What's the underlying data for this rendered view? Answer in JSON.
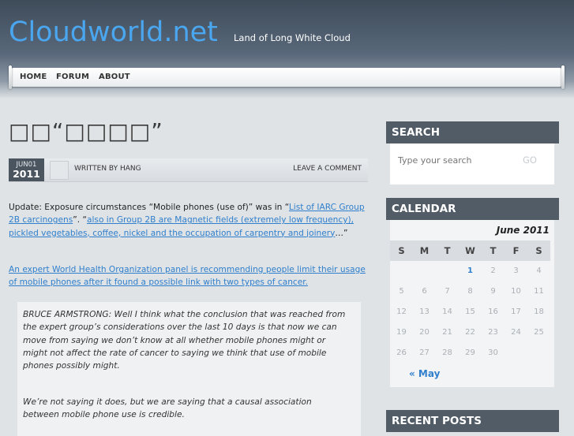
{
  "header": {
    "site_title": "Cloudworld.net",
    "tagline": "Land of Long White Cloud"
  },
  "nav": {
    "items": [
      {
        "label": "HOME"
      },
      {
        "label": "FORUM"
      },
      {
        "label": "ABOUT"
      }
    ]
  },
  "post": {
    "title": "□□“□□□□”",
    "date": {
      "month_day": "JUN01",
      "year": "2011"
    },
    "written_by": "WRITTEN BY HANG",
    "leave_comment": "LEAVE A COMMENT",
    "para1": {
      "prefix": "Update: Exposure circumstances “Mobile phones (use of)” was in “",
      "link1": "List of IARC Group 2B carcinogens",
      "middle": "”. “",
      "link2": "also in Group 2B are Magnetic fields (extremely low frequency), pickled vegetables, coffee, nickel and the occupation of carpentry and joinery",
      "suffix": "…”"
    },
    "para2_link": "An expert World Health Organization panel is recommending people limit their usage of mobile phones after it found a possible link with two types of cancer.",
    "quote": {
      "p1": "BRUCE ARMSTRONG: Well I think what the conclusion that was reached from the expert group’s considerations over the last 10 days is that now we can move from saying we don’t know at all whether mobile phones might or might not affect the rate of cancer to saying we think that use of mobile phones possibly might.",
      "p2": "We’re not saying it does, but we are saying that a causal association between mobile phone use is credible."
    }
  },
  "sidebar": {
    "search": {
      "title": "SEARCH",
      "placeholder": "Type your search",
      "go_label": "GO"
    },
    "calendar": {
      "title": "CALENDAR",
      "caption": "June 2011",
      "weekdays": [
        "S",
        "M",
        "T",
        "W",
        "T",
        "F",
        "S"
      ],
      "weeks": [
        [
          "",
          "",
          "",
          "1",
          "2",
          "3",
          "4"
        ],
        [
          "5",
          "6",
          "7",
          "8",
          "9",
          "10",
          "11"
        ],
        [
          "12",
          "13",
          "14",
          "15",
          "16",
          "17",
          "18"
        ],
        [
          "19",
          "20",
          "21",
          "22",
          "23",
          "24",
          "25"
        ],
        [
          "26",
          "27",
          "28",
          "29",
          "30",
          "",
          ""
        ]
      ],
      "linked_day": "1",
      "prev_label": "« May"
    },
    "recent_posts": {
      "title": "RECENT POSTS"
    }
  },
  "colors": {
    "accent": "#2f7fcc",
    "title_blue": "#4aa6ef",
    "widget_header": "#515c67"
  }
}
